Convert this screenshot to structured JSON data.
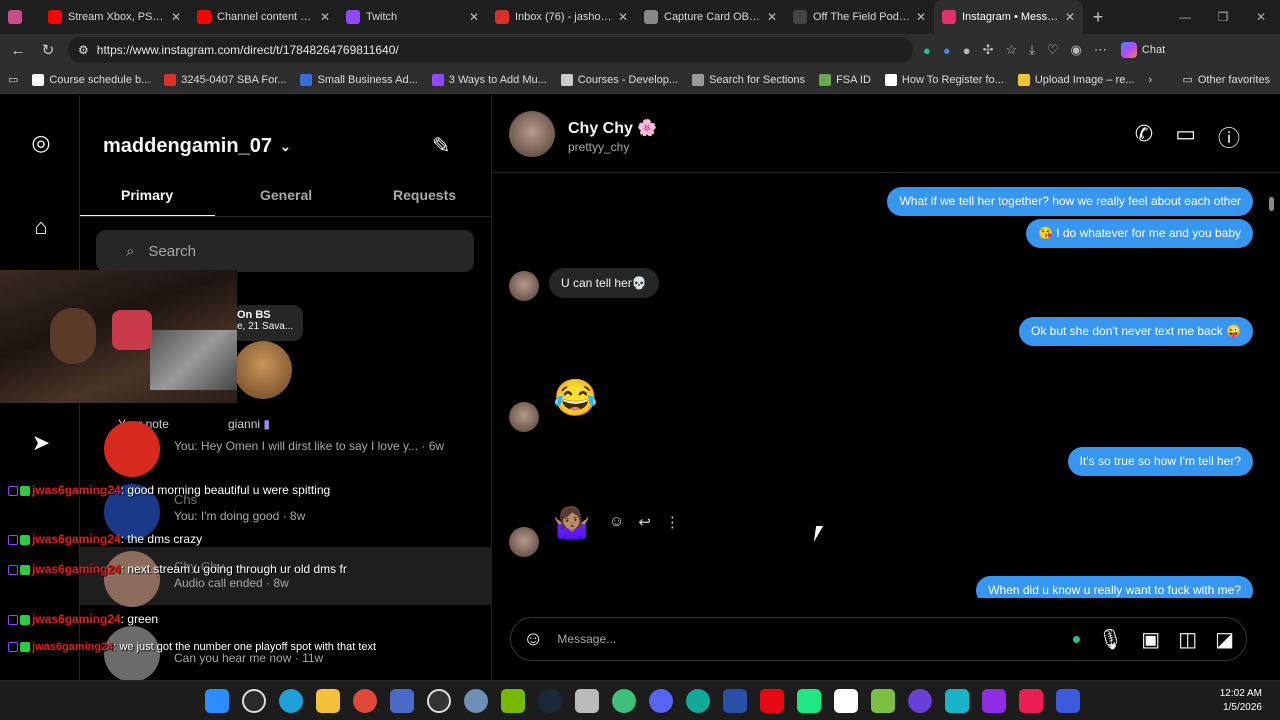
{
  "browser": {
    "tabs": [
      {
        "label": "",
        "color": "#c74d8a"
      },
      {
        "label": "Stream Xbox, PS5 & PS",
        "color": "#ff0000"
      },
      {
        "label": "Channel content - You",
        "color": "#ff0000"
      },
      {
        "label": "Twitch",
        "color": "#9146ff"
      },
      {
        "label": "Inbox (76) - jashonjone",
        "color": "#d93025"
      },
      {
        "label": "Capture Card OBS Setu",
        "color": "#888888"
      },
      {
        "label": "Off The Field Podcast",
        "color": "#222222"
      },
      {
        "label": "Instagram • Messages",
        "color": "#e1306c"
      }
    ],
    "url": "https://www.instagram.com/direct/t/17848264769811640/",
    "chat_label": "Chat",
    "favorites": [
      {
        "label": "Course schedule b...",
        "color": "#ffffff"
      },
      {
        "label": "3245-0407 SBA For...",
        "color": "#d93025"
      },
      {
        "label": "Small Business Ad...",
        "color": "#3a6fd8"
      },
      {
        "label": "3 Ways to Add Mu...",
        "color": "#9146ff"
      },
      {
        "label": "Courses - Develop...",
        "color": "#cccccc"
      },
      {
        "label": "Search for Sections",
        "color": "#9a9a9a"
      },
      {
        "label": "FSA ID",
        "color": "#6aa84f"
      },
      {
        "label": "How To Register fo...",
        "color": "#ffffff"
      },
      {
        "label": "Upload Image – re...",
        "color": "#f1c232"
      }
    ],
    "other_favorites": "Other favorites"
  },
  "inbox": {
    "username": "maddengamin_07",
    "tabs": [
      "Primary",
      "General",
      "Requests"
    ],
    "search_placeholder": "Search",
    "note": {
      "title": "On BS",
      "sub": "e, 21 Sava...",
      "your_note": "Your note",
      "friend": "gianni"
    },
    "conversations": [
      {
        "name": "",
        "preview": "You: Hey Omen I will dirst like to say I love y... · 6w",
        "color": "#d62a1f"
      },
      {
        "name": "Chs",
        "preview": "You: I'm doing good · 8w",
        "color": "#1b3a8a"
      },
      {
        "name": "Chy Chy",
        "preview": "Audio call ended · 8w",
        "color": "#8c6c5c"
      },
      {
        "name": "",
        "preview": "Can you hear me now · 11w",
        "color": "#6b6b6b"
      }
    ]
  },
  "stream_chat": [
    {
      "user": "jwas6gaming24",
      "text": "good morning beautiful u were spitting"
    },
    {
      "user": "jwas6gaming24",
      "text": "the dms crazy"
    },
    {
      "user": "jwas6gaming24",
      "text": "next stream u going through ur old dms fr"
    },
    {
      "user": "jwas6gaming24",
      "text": "green"
    },
    {
      "user": "jwas6gaming24",
      "text": "we just got the number one playoff spot with that text"
    }
  ],
  "thread": {
    "name": "Chy Chy 🌸",
    "handle": "prettyy_chy",
    "messages": [
      {
        "dir": "out",
        "text": "What if we tell her together? how we really feel about each other"
      },
      {
        "dir": "out",
        "text": "😘 I do whatever for me and you baby"
      },
      {
        "dir": "in",
        "text": "U can tell her💀"
      },
      {
        "dir": "out",
        "text": "Ok but she don't never text me back 😜"
      },
      {
        "dir": "in",
        "text": "😂"
      },
      {
        "dir": "out",
        "text": "It's so true so how I'm tell her?"
      },
      {
        "dir": "in",
        "text": "🤷🏽‍♀️"
      },
      {
        "dir": "out",
        "text": "When did u know u really want to fuck with me?"
      }
    ],
    "composer_placeholder": "Message..."
  },
  "taskbar": {
    "time": "12:02 AM",
    "date": "1/5/2026"
  }
}
